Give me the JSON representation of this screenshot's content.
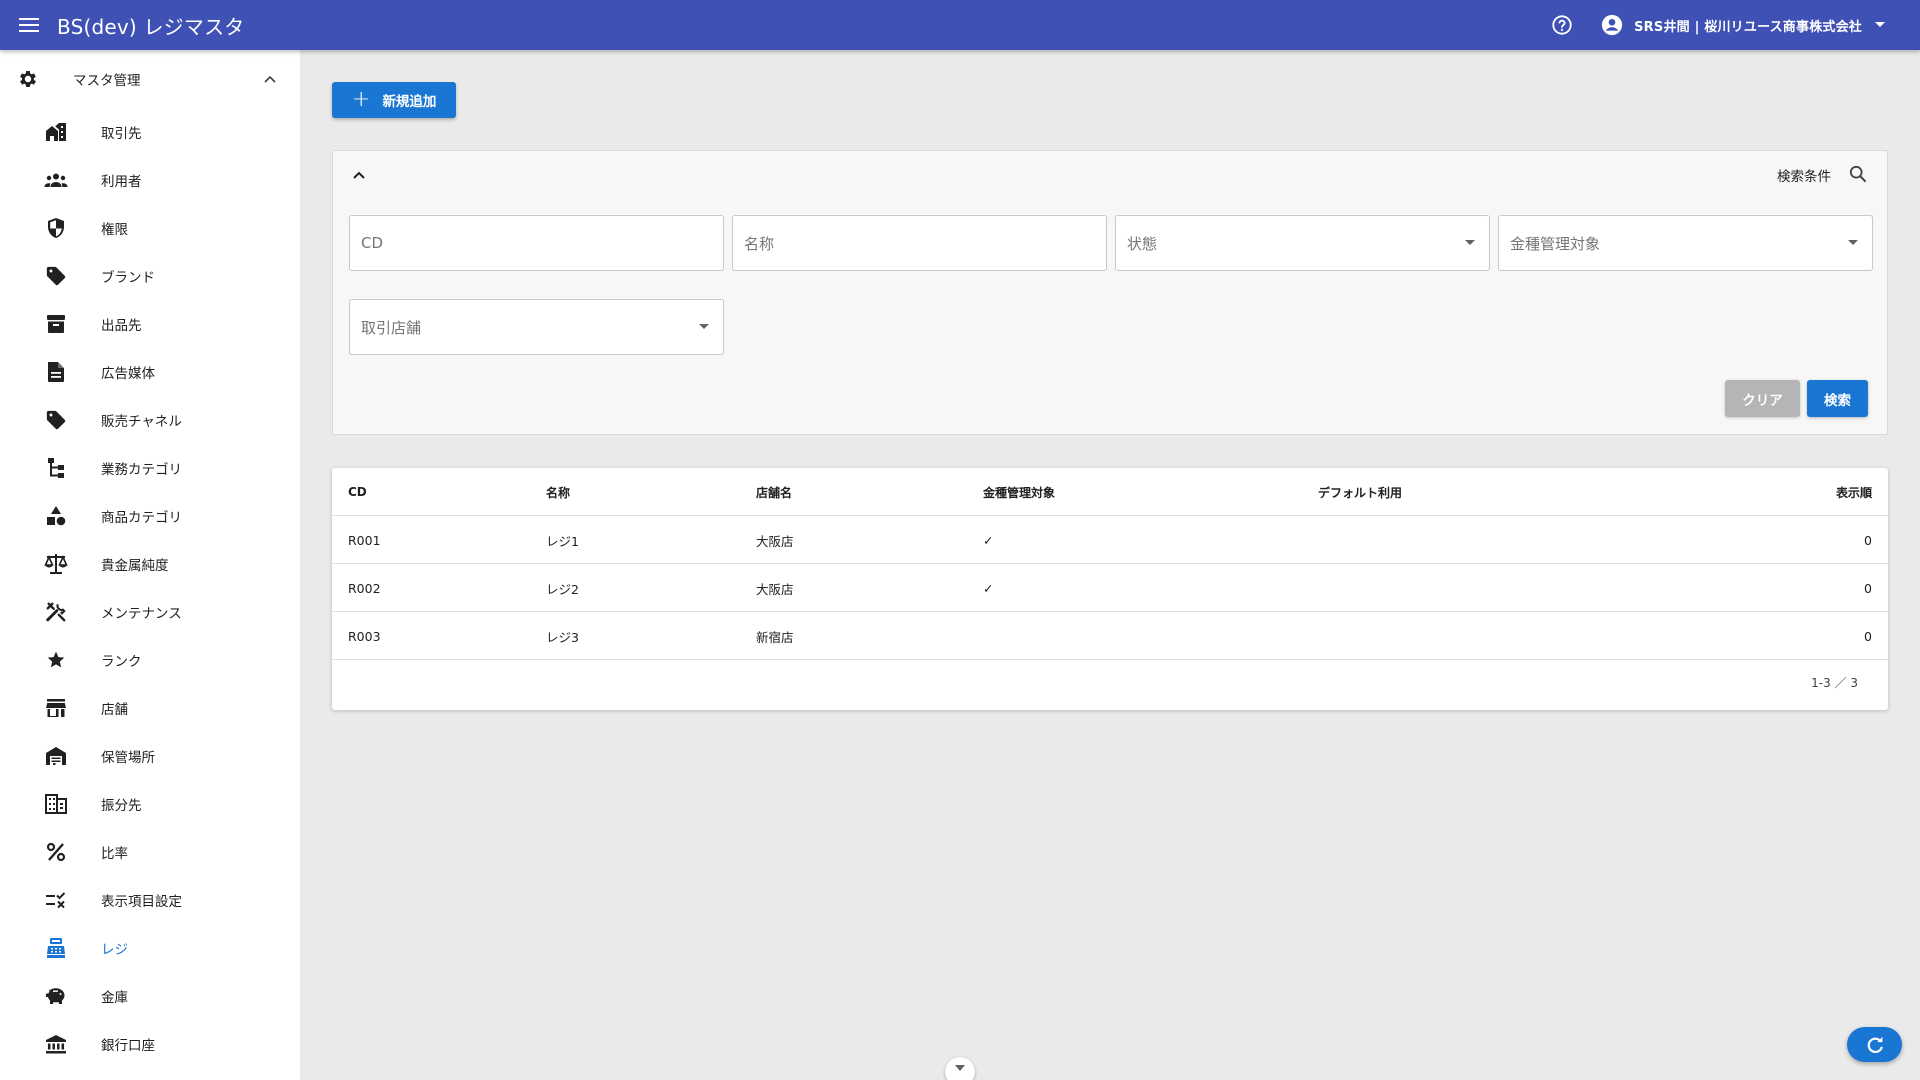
{
  "app": {
    "title": "BS(dev) レジマスタ",
    "account_name": "SRS井間 | 桜川リユース商事株式会社"
  },
  "colors": {
    "appbar": "#3f51b5",
    "primary": "#1976d2",
    "active_nav": "#1976d2"
  },
  "sidebar": {
    "group_label": "マスタ管理",
    "group_icon": "gear-icon",
    "items": [
      {
        "label": "取引先",
        "icon": "building-icon"
      },
      {
        "label": "利用者",
        "icon": "group-icon"
      },
      {
        "label": "権限",
        "icon": "shield-icon"
      },
      {
        "label": "ブランド",
        "icon": "tag-icon"
      },
      {
        "label": "出品先",
        "icon": "archive-icon"
      },
      {
        "label": "広告媒体",
        "icon": "document-icon"
      },
      {
        "label": "販売チャネル",
        "icon": "tag-icon"
      },
      {
        "label": "業務カテゴリ",
        "icon": "tree-icon"
      },
      {
        "label": "商品カテゴリ",
        "icon": "shapes-icon"
      },
      {
        "label": "貴金属純度",
        "icon": "scale-icon"
      },
      {
        "label": "メンテナンス",
        "icon": "tools-icon"
      },
      {
        "label": "ランク",
        "icon": "star-icon"
      },
      {
        "label": "店舗",
        "icon": "store-icon"
      },
      {
        "label": "保管場所",
        "icon": "warehouse-icon"
      },
      {
        "label": "振分先",
        "icon": "domain-icon"
      },
      {
        "label": "比率",
        "icon": "percent-icon"
      },
      {
        "label": "表示項目設定",
        "icon": "list-check-icon"
      },
      {
        "label": "レジ",
        "icon": "register-icon",
        "active": true
      },
      {
        "label": "金庫",
        "icon": "piggy-bank-icon"
      },
      {
        "label": "銀行口座",
        "icon": "bank-icon"
      }
    ]
  },
  "main": {
    "add_button_label": "新規追加",
    "search": {
      "title": "検索条件",
      "fields": {
        "cd": "CD",
        "name": "名称",
        "status": "状態",
        "kinshu": "金種管理対象",
        "store": "取引店舗"
      },
      "clear_label": "クリア",
      "search_label": "検索"
    },
    "table": {
      "headers": {
        "cd": "CD",
        "name": "名称",
        "store": "店舗名",
        "kinshu": "金種管理対象",
        "default": "デフォルト利用",
        "order": "表示順"
      },
      "rows": [
        {
          "cd": "R001",
          "name": "レジ1",
          "store": "大阪店",
          "kinshu": "✓",
          "default": "",
          "order": "0"
        },
        {
          "cd": "R002",
          "name": "レジ2",
          "store": "大阪店",
          "kinshu": "✓",
          "default": "",
          "order": "0"
        },
        {
          "cd": "R003",
          "name": "レジ3",
          "store": "新宿店",
          "kinshu": "",
          "default": "",
          "order": "0"
        }
      ],
      "pagination": "1-3 ／ 3"
    }
  }
}
